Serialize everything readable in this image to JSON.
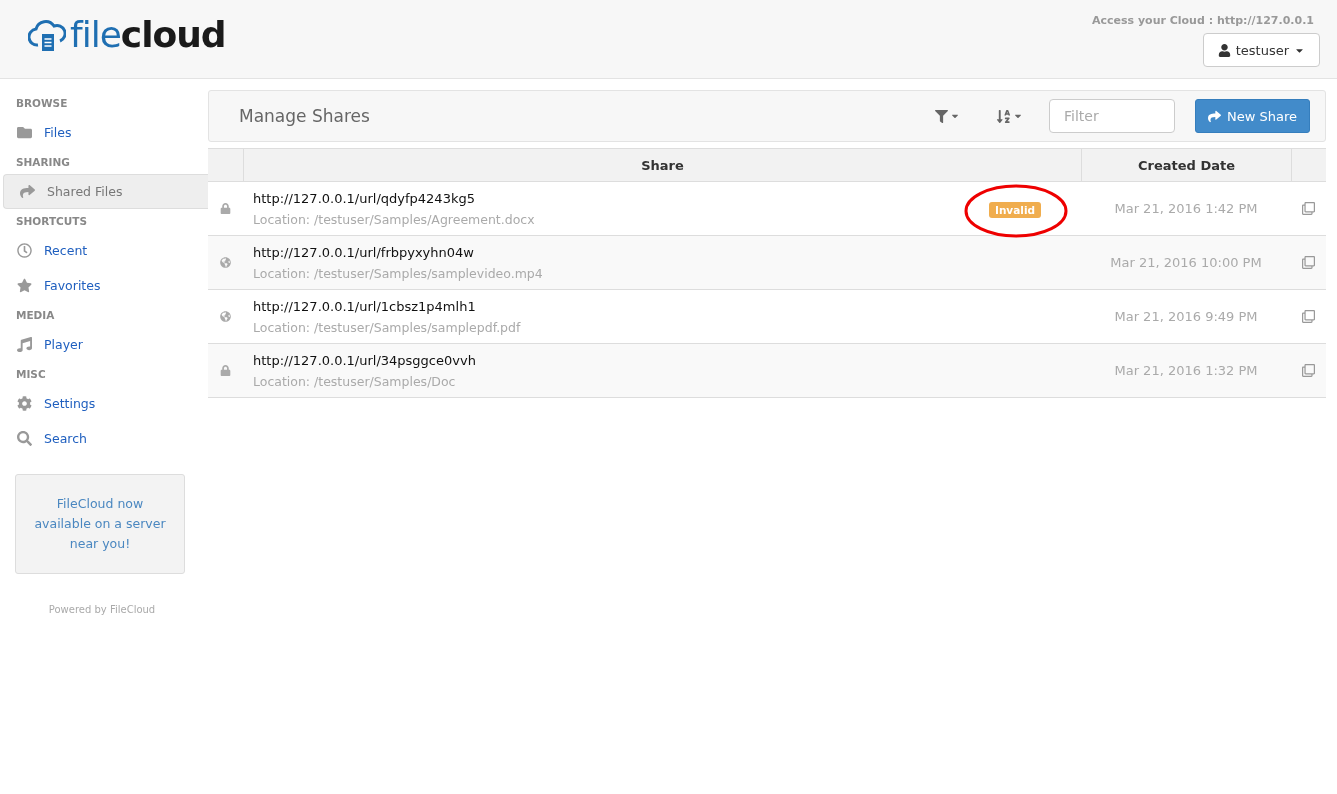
{
  "logo": {
    "light": "file",
    "bold": "cloud"
  },
  "header": {
    "access_text": "Access your Cloud : http://127.0.0.1",
    "user_button": "testuser"
  },
  "sidebar": {
    "sections": [
      {
        "heading": "BROWSE",
        "items": [
          {
            "label": "Files",
            "selected": false
          }
        ]
      },
      {
        "heading": "SHARING",
        "items": [
          {
            "label": "Shared Files",
            "selected": true
          }
        ]
      },
      {
        "heading": "SHORTCUTS",
        "items": [
          {
            "label": "Recent",
            "selected": false
          },
          {
            "label": "Favorites",
            "selected": false
          }
        ]
      },
      {
        "heading": "MEDIA",
        "items": [
          {
            "label": "Player",
            "selected": false
          }
        ]
      },
      {
        "heading": "MISC",
        "items": [
          {
            "label": "Settings",
            "selected": false
          },
          {
            "label": "Search",
            "selected": false
          }
        ]
      }
    ],
    "promo": "FileCloud now available on a server near you!",
    "footer": "Powered by FileCloud"
  },
  "toolbar": {
    "title": "Manage Shares",
    "filter_placeholder": "Filter",
    "new_button": "New Share"
  },
  "table": {
    "columns": [
      "Share",
      "Created Date"
    ],
    "rows": [
      {
        "kind": "private",
        "url": "http://127.0.0.1/url/qdyfp4243kg5",
        "location": "Location: /testuser/Samples/Agreement.docx",
        "badge": "Invalid",
        "date": "Mar 21, 2016 1:42 PM"
      },
      {
        "kind": "public",
        "url": "http://127.0.0.1/url/frbpyxyhn04w",
        "location": "Location: /testuser/Samples/samplevideo.mp4",
        "date": "Mar 21, 2016 10:00 PM"
      },
      {
        "kind": "public",
        "url": "http://127.0.0.1/url/1cbsz1p4mlh1",
        "location": "Location: /testuser/Samples/samplepdf.pdf",
        "date": "Mar 21, 2016 9:49 PM"
      },
      {
        "kind": "private",
        "url": "http://127.0.0.1/url/34psggce0vvh",
        "location": "Location: /testuser/Samples/Doc",
        "date": "Mar 21, 2016 1:32 PM"
      }
    ]
  }
}
